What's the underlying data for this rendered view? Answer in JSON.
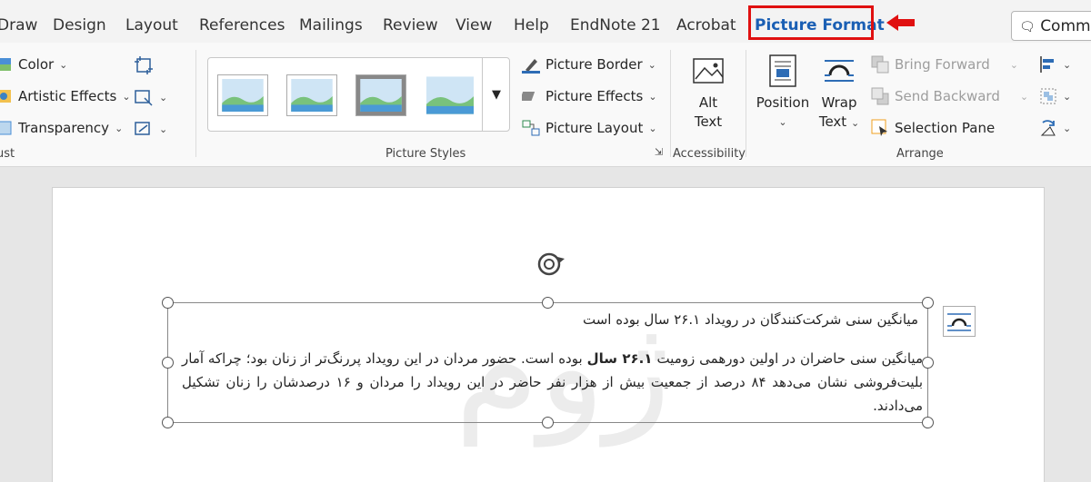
{
  "tabs": [
    {
      "label": "Draw"
    },
    {
      "label": "Design"
    },
    {
      "label": "Layout"
    },
    {
      "label": "References"
    },
    {
      "label": "Mailings"
    },
    {
      "label": "Review"
    },
    {
      "label": "View"
    },
    {
      "label": "Help"
    },
    {
      "label": "EndNote 21"
    },
    {
      "label": "Acrobat"
    },
    {
      "label": "Picture Format"
    }
  ],
  "active_tab": "Picture Format",
  "comments_label": "Comme",
  "adjust": {
    "color": "Color",
    "artistic_effects": "Artistic Effects",
    "transparency": "Transparency",
    "group_label": "ust"
  },
  "picture_styles": {
    "border": "Picture Border",
    "effects": "Picture Effects",
    "layout": "Picture Layout",
    "group_label": "Picture Styles"
  },
  "accessibility": {
    "alt_text_line1": "Alt",
    "alt_text_line2": "Text",
    "group_label": "Accessibility"
  },
  "arrange": {
    "position": "Position",
    "wrap_text_line1": "Wrap",
    "wrap_text_line2": "Text",
    "bring_forward": "Bring Forward",
    "send_backward": "Send Backward",
    "selection_pane": "Selection Pane",
    "group_label": "Arrange"
  },
  "document": {
    "title": "میانگین سنی شرکت‌کنندگان در رویداد ۲۶.۱ سال بوده است",
    "body_part1": "میانگین سنی حاضران در اولین دورهمی زومیت ",
    "body_bold": "۲۶.۱ سال",
    "body_part2": " بوده است. حضور مردان در این رویداد پررنگ‌تر از زنان بود؛ چراکه آمار بلیت‌فروشی نشان می‌دهد ۸۴ درصد از جمعیت بیش از هزار نفر حاضر در این رویداد را مردان و ۱۶ درصدشان را زنان تشکیل می‌دادند.",
    "watermark": "ژوم"
  },
  "colors": {
    "accent": "#1a5fb4",
    "highlight": "#e01010"
  }
}
